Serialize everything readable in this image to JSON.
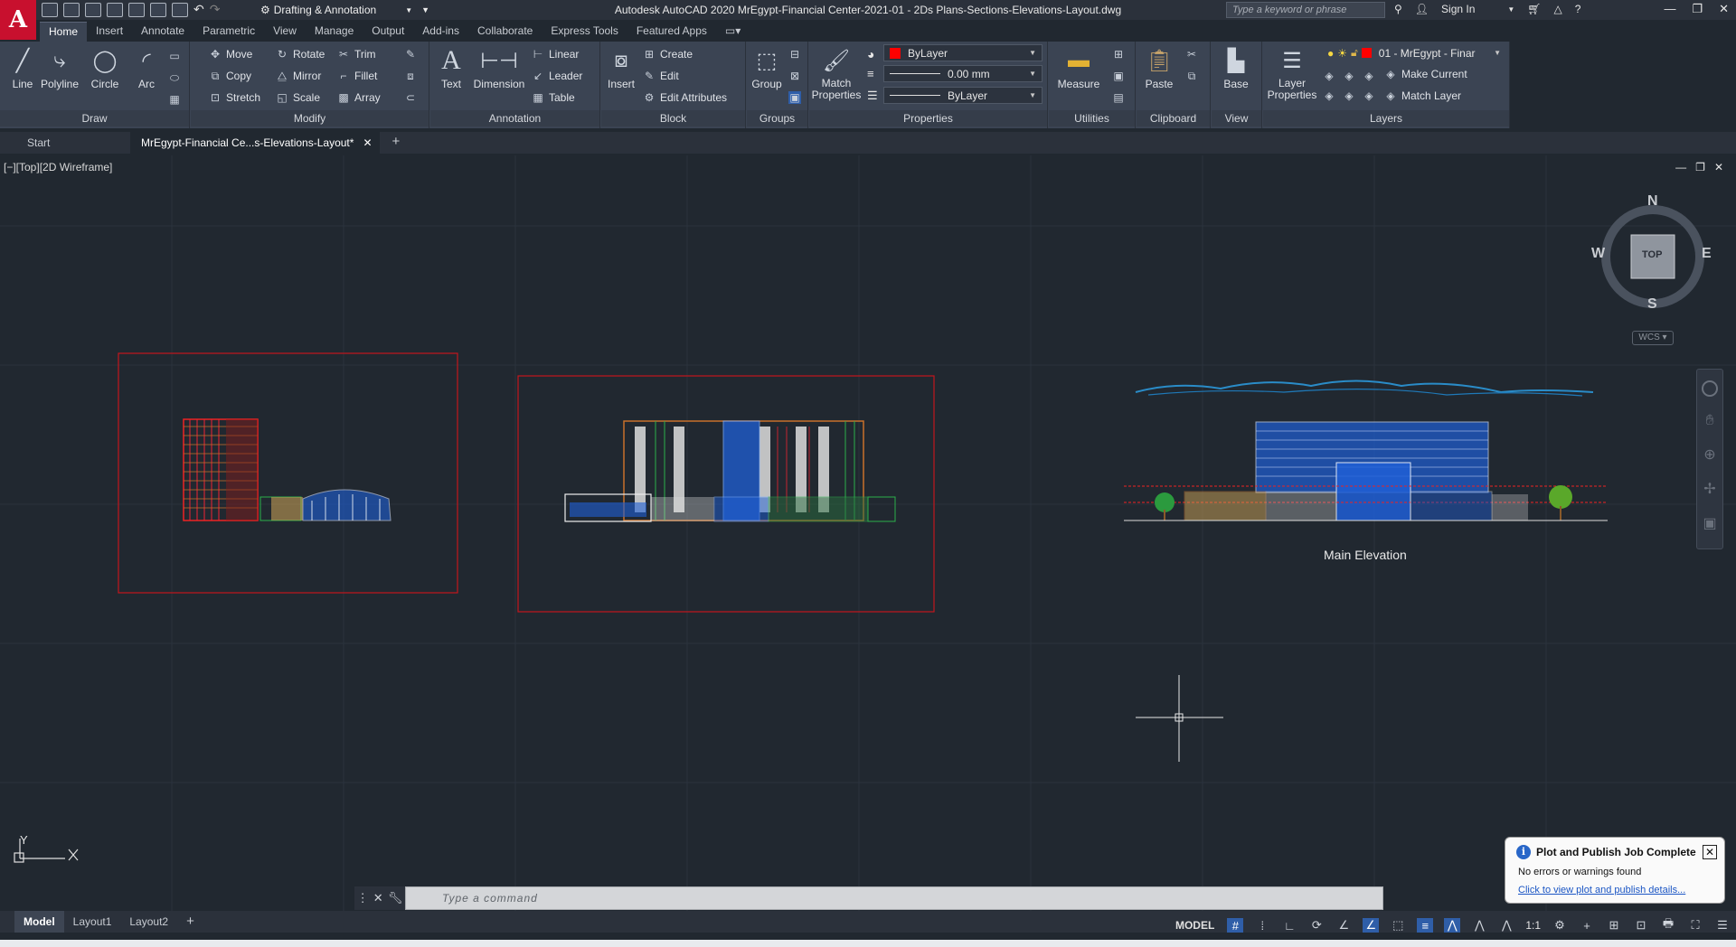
{
  "app": {
    "window_title": "Autodesk AutoCAD 2020    MrEgypt-Financial Center-2021-01 - 2Ds Plans-Sections-Elevations-Layout.dwg",
    "logo_letter": "A",
    "workspace": "Drafting & Annotation",
    "search_placeholder": "Type a keyword or phrase",
    "sign_in": "Sign In"
  },
  "ribbon_tabs": [
    "Home",
    "Insert",
    "Annotate",
    "Parametric",
    "View",
    "Manage",
    "Output",
    "Add-ins",
    "Collaborate",
    "Express Tools",
    "Featured Apps"
  ],
  "panels": {
    "draw": {
      "title": "Draw",
      "line": "Line",
      "polyline": "Polyline",
      "circle": "Circle",
      "arc": "Arc"
    },
    "modify": {
      "title": "Modify",
      "move": "Move",
      "rotate": "Rotate",
      "trim": "Trim",
      "copy": "Copy",
      "mirror": "Mirror",
      "fillet": "Fillet",
      "stretch": "Stretch",
      "scale": "Scale",
      "array": "Array"
    },
    "annotation": {
      "title": "Annotation",
      "text": "Text",
      "dimension": "Dimension",
      "linear": "Linear",
      "leader": "Leader",
      "table": "Table"
    },
    "block": {
      "title": "Block",
      "insert": "Insert",
      "create": "Create",
      "edit": "Edit",
      "edit_attributes": "Edit Attributes"
    },
    "groups": {
      "title": "Groups",
      "group": "Group"
    },
    "properties": {
      "title": "Properties",
      "match": "Match Properties",
      "color": "ByLayer",
      "lineweight": "0.00 mm",
      "linetype": "ByLayer"
    },
    "utilities": {
      "title": "Utilities",
      "measure": "Measure"
    },
    "clipboard": {
      "title": "Clipboard",
      "paste": "Paste"
    },
    "view": {
      "title": "View",
      "base": "Base"
    },
    "layers": {
      "title": "Layers",
      "layer_properties": "Layer Properties",
      "current_layer": "01 - MrEgypt - Finar",
      "make_current": "Make Current",
      "match_layer": "Match Layer"
    }
  },
  "file_tabs": [
    "Start",
    "MrEgypt-Financial Ce...s-Elevations-Layout*"
  ],
  "viewport": {
    "view_label": "[−][Top][2D Wireframe]",
    "compass": {
      "n": "N",
      "s": "S",
      "e": "E",
      "w": "W",
      "top": "TOP",
      "wcs": "WCS"
    },
    "elevation_label": "Main Elevation",
    "ucs_x": "X",
    "ucs_y": "Y"
  },
  "command": {
    "placeholder": "Type  a  command"
  },
  "layout_tabs": [
    "Model",
    "Layout1",
    "Layout2"
  ],
  "status": {
    "model": "MODEL",
    "scale": "1:1"
  },
  "notification": {
    "title": "Plot and Publish Job Complete",
    "body": "No errors or warnings found",
    "link": "Click to view plot and publish details..."
  },
  "colors": {
    "accent_red": "#c8102e",
    "viewport_bg": "#212830",
    "frame_red": "#c4161c",
    "elev_blue": "#1f5fd6"
  }
}
